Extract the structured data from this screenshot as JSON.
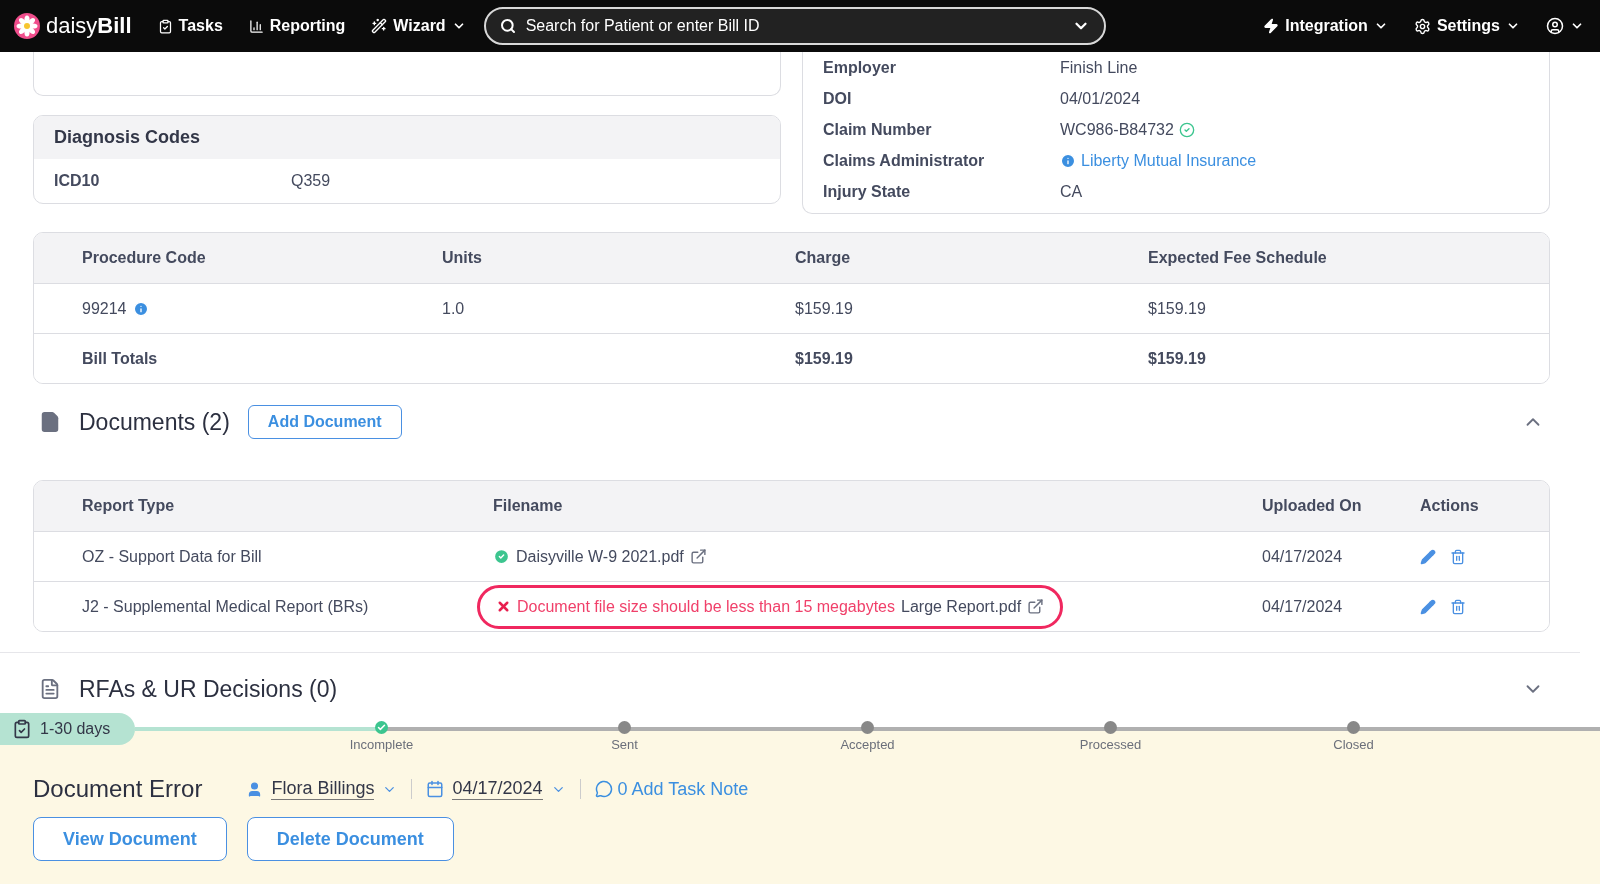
{
  "navbar": {
    "logo": "daisy**Bill**",
    "items": [
      {
        "label": "Tasks",
        "dropdown": false
      },
      {
        "label": "Reporting",
        "dropdown": false
      },
      {
        "label": "Wizard",
        "dropdown": true
      }
    ],
    "search": {
      "placeholder": "Search for Patient or enter Bill ID"
    },
    "right_items": [
      {
        "label": "Integration",
        "dropdown": true
      },
      {
        "label": "Settings",
        "dropdown": true
      }
    ]
  },
  "claim_info": [
    {
      "label": "Employer",
      "value": "Finish Line",
      "kind": "text"
    },
    {
      "label": "DOI",
      "value": "04/01/2024",
      "kind": "text"
    },
    {
      "label": "Claim Number",
      "value": "WC986-B84732",
      "kind": "verified"
    },
    {
      "label": "Claims Administrator",
      "value": "Liberty Mutual Insurance",
      "kind": "link"
    },
    {
      "label": "Injury State",
      "value": "CA",
      "kind": "text"
    }
  ],
  "diagnosis": {
    "title": "Diagnosis Codes",
    "rows": [
      {
        "code_set": "ICD10",
        "code": "Q359"
      }
    ]
  },
  "procedures": {
    "columns": [
      "Procedure Code",
      "Units",
      "Charge",
      "Expected Fee Schedule"
    ],
    "rows": [
      {
        "code": "99214",
        "info": true,
        "units": "1.0",
        "charge": "$159.19",
        "expected": "$159.19"
      }
    ],
    "totals": {
      "label": "Bill Totals",
      "charge": "$159.19",
      "expected": "$159.19"
    }
  },
  "documents": {
    "title": "Documents (2)",
    "add_button": "Add Document",
    "expanded": true,
    "columns": [
      "Report Type",
      "Filename",
      "Uploaded On",
      "Actions"
    ],
    "rows": [
      {
        "report_type": "OZ - Support Data for Bill",
        "valid": true,
        "filename": "Daisyville W-9 2021.pdf",
        "uploaded_on": "04/17/2024",
        "highlighted": false
      },
      {
        "report_type": "J2 - Supplemental Medical Report (BRs)",
        "valid": false,
        "error": "Document file size should be less than 15 megabytes",
        "filename": "Large Report.pdf",
        "uploaded_on": "04/17/2024",
        "highlighted": true
      }
    ]
  },
  "rfas": {
    "title": "RFAs & UR Decisions (0)",
    "expanded": false
  },
  "task": {
    "badge": "1-30 days",
    "steps": [
      {
        "label": "Incomplete",
        "done": true
      },
      {
        "label": "Sent",
        "done": false
      },
      {
        "label": "Accepted",
        "done": false
      },
      {
        "label": "Processed",
        "done": false
      },
      {
        "label": "Closed",
        "done": false
      }
    ],
    "title": "Document Error",
    "assignee": "Flora Billings",
    "date": "04/17/2024",
    "note": "0 Add Task Note",
    "buttons": [
      "View Document",
      "Delete Document"
    ]
  }
}
